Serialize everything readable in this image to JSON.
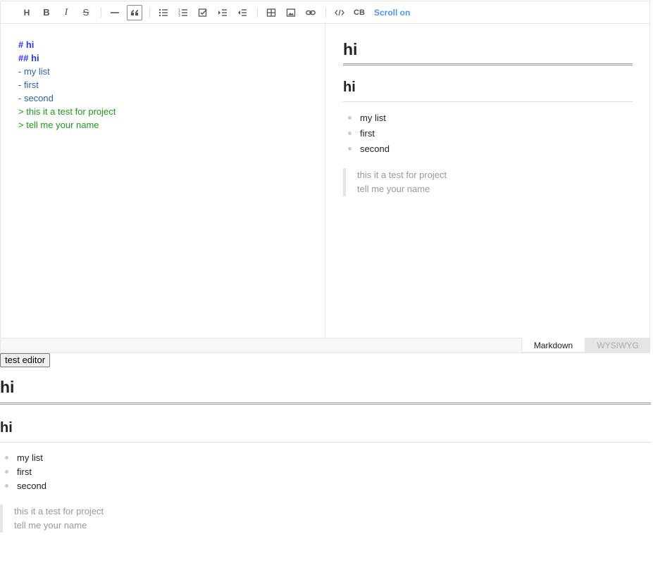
{
  "toolbar": {
    "buttons": [
      {
        "name": "heading-icon",
        "label": "H"
      },
      {
        "name": "bold-icon",
        "label": "B"
      },
      {
        "name": "italic-icon",
        "label": "I"
      },
      {
        "name": "strike-icon",
        "label": "S"
      },
      {
        "name": "hr-icon",
        "label": ""
      },
      {
        "name": "quote-icon",
        "label": ""
      },
      {
        "name": "bullet-list-icon",
        "label": ""
      },
      {
        "name": "ordered-list-icon",
        "label": ""
      },
      {
        "name": "task-list-icon",
        "label": ""
      },
      {
        "name": "indent-icon",
        "label": ""
      },
      {
        "name": "outdent-icon",
        "label": ""
      },
      {
        "name": "table-icon",
        "label": ""
      },
      {
        "name": "image-icon",
        "label": ""
      },
      {
        "name": "link-icon",
        "label": ""
      },
      {
        "name": "code-icon",
        "label": ""
      },
      {
        "name": "codeblock-icon",
        "label": "CB"
      }
    ],
    "scroll_sync_label": "Scroll on"
  },
  "markdown": {
    "lines": [
      "# hi",
      "## hi",
      "- my list",
      "- first",
      "- second",
      "> this it a test for project",
      "> tell me your name"
    ]
  },
  "preview": {
    "h1": "hi",
    "h2": "hi",
    "list": [
      "my list",
      "first",
      "second"
    ],
    "quote": [
      "this it a test for project",
      "tell me your name"
    ]
  },
  "mode_tabs": {
    "markdown": "Markdown",
    "wysiwyg": "WYSIWYG"
  },
  "test_button_label": "test editor",
  "output": {
    "h1": "hi",
    "h2": "hi",
    "list": [
      "my list",
      "first",
      "second"
    ],
    "quote": [
      "this it a test for project",
      "tell me your name"
    ]
  },
  "colors": {
    "md_heading": "#2e35e6",
    "md_list": "#2a64a6",
    "md_quote": "#1d9a18",
    "scroll_sync": "#4b96e6"
  }
}
